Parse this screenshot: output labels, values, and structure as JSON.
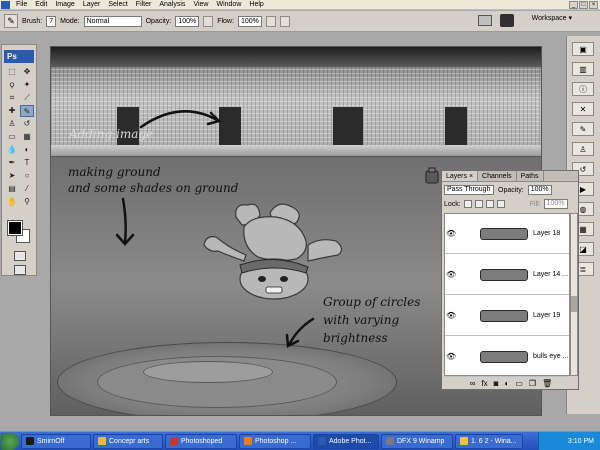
{
  "menubar": {
    "items": [
      "File",
      "Edit",
      "Image",
      "Layer",
      "Select",
      "Filter",
      "Analysis",
      "View",
      "Window",
      "Help"
    ]
  },
  "options": {
    "brush_label": "Brush:",
    "brush_size": "7",
    "mode_label": "Mode:",
    "mode_value": "Normal",
    "opacity_label": "Opacity:",
    "opacity_value": "100%",
    "flow_label": "Flow:",
    "flow_value": "100%",
    "workspace_label": "Workspace ▾"
  },
  "toolbox": {
    "logo": "Ps"
  },
  "canvas": {
    "annotations": {
      "adding_image": "Adding image",
      "ground_line1": "making ground",
      "ground_line2": "and some shades on ground",
      "circles_line1": "Group of circles",
      "circles_line2": "with varying",
      "circles_line3": "brightness"
    }
  },
  "layers_panel": {
    "tabs": [
      "Layers ×",
      "Channels",
      "Paths"
    ],
    "blend_mode": "Pass Through",
    "opacity_label": "Opacity:",
    "opacity_value": "100%",
    "lock_label": "Lock:",
    "fill_label": "Fill:",
    "fill_value": "100%",
    "layers": [
      {
        "name": "Layer 18"
      },
      {
        "name": "Layer 14 ..."
      },
      {
        "name": "Layer 19"
      },
      {
        "name": "bulls eye ..."
      }
    ]
  },
  "taskbar": {
    "items": [
      {
        "label": "SmirnOff",
        "color": "#1a1a1a"
      },
      {
        "label": "Concepr arts",
        "color": "#e6b84a"
      },
      {
        "label": "Photoshoped",
        "color": "#c0392b"
      },
      {
        "label": "Photoshop ...",
        "color": "#e67e22"
      },
      {
        "label": "Adobe Phot...",
        "color": "#2a5bb0"
      },
      {
        "label": "DFX 9 Winamp",
        "color": "#7a7a7a"
      },
      {
        "label": "1. 6 2 - Wina...",
        "color": "#f0c040"
      }
    ],
    "active_index": 4,
    "clock": "3:10 PM"
  }
}
